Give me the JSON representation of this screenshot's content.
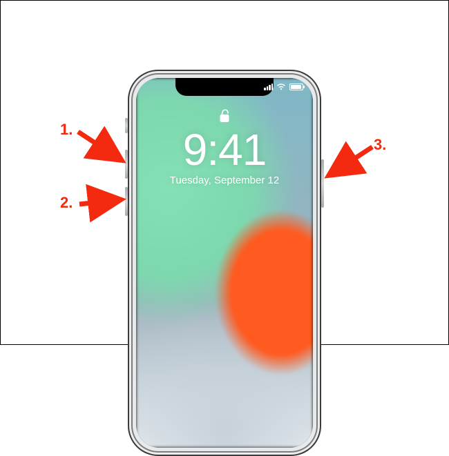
{
  "lockscreen": {
    "time": "9:41",
    "date": "Tuesday, September 12"
  },
  "callouts": {
    "one": "1.",
    "two": "2.",
    "three": "3."
  },
  "buttons": {
    "volume_up": "Volume Up button",
    "volume_down": "Volume Down button",
    "side": "Side button",
    "silent": "Ring/Silent switch"
  },
  "status": {
    "signal": "cellular-signal-icon",
    "wifi": "wifi-icon",
    "battery": "battery-icon"
  },
  "colors": {
    "accent": "#f32a0f"
  }
}
